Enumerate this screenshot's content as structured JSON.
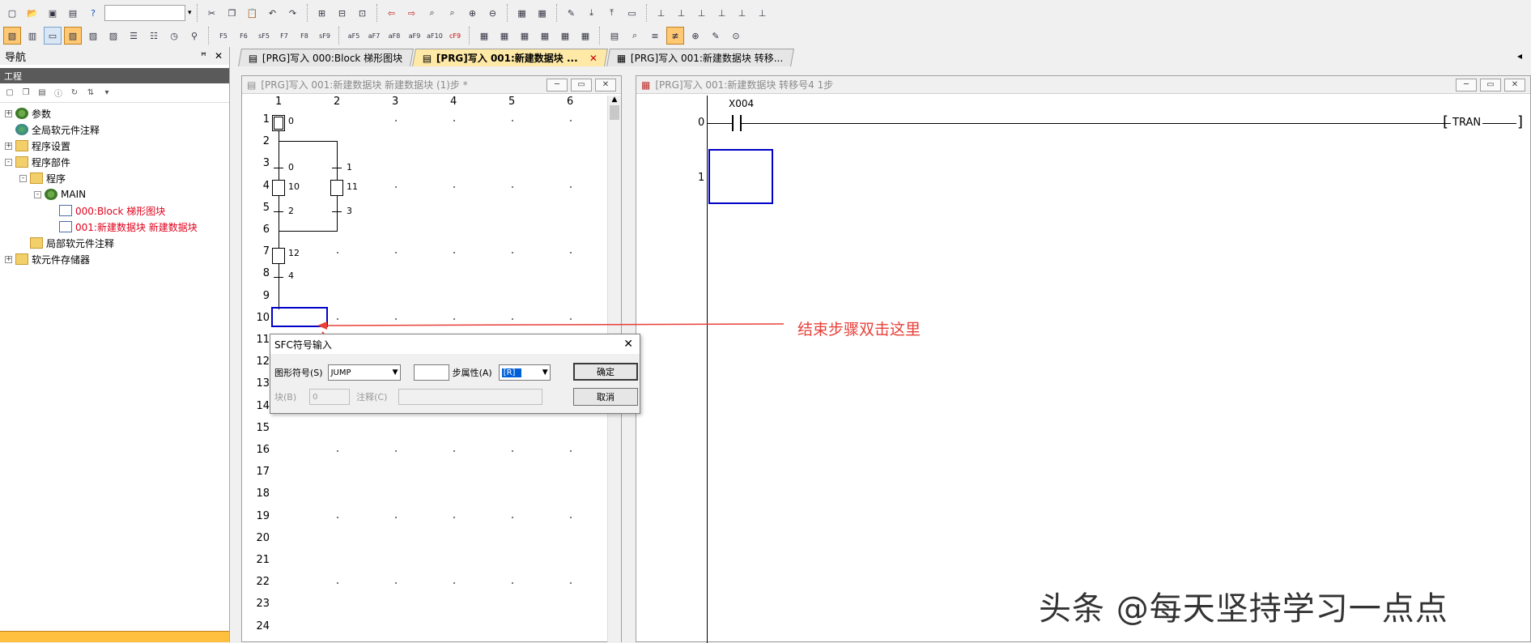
{
  "toolbar": {
    "combo1": "",
    "row1_icons": [
      "new-icon",
      "open-icon",
      "save-icon",
      "print-icon",
      "help-icon",
      "cut-icon",
      "copy-icon",
      "paste-icon",
      "undo-icon",
      "redo-icon",
      "dev-icon",
      "dev2-icon",
      "ocr-icon",
      "find-icon",
      "jump-icon",
      "zoom-icon",
      "device-icon",
      "f-icon",
      "monitor-icon"
    ],
    "row2_labels": [
      "F5",
      "F6",
      "sF5",
      "F7",
      "F8",
      "sF9",
      "aF5",
      "aF7",
      "aF8",
      "aF9",
      "aF10",
      "cF9"
    ]
  },
  "nav": {
    "title": "导航",
    "pin": "ꟸ",
    "close": "✕",
    "section": "工程",
    "tree": [
      {
        "label": "参数",
        "level": 0,
        "expander": "+",
        "icon": "gear"
      },
      {
        "label": "全局软元件注释",
        "level": 0,
        "expander": "",
        "icon": "globe"
      },
      {
        "label": "程序设置",
        "level": 0,
        "expander": "+",
        "icon": "folder"
      },
      {
        "label": "程序部件",
        "level": 0,
        "expander": "−",
        "icon": "folder"
      },
      {
        "label": "程序",
        "level": 1,
        "expander": "−",
        "icon": "folder"
      },
      {
        "label": "MAIN",
        "level": 2,
        "expander": "−",
        "icon": "gear"
      },
      {
        "label": "000:Block 梯形图块",
        "level": 3,
        "expander": "",
        "icon": "doc",
        "red": true
      },
      {
        "label": "001:新建数据块 新建数据块",
        "level": 3,
        "expander": "",
        "icon": "doc",
        "red": true
      },
      {
        "label": "局部软元件注释",
        "level": 1,
        "expander": "",
        "icon": "folder"
      },
      {
        "label": "软元件存储器",
        "level": 0,
        "expander": "+",
        "icon": "folder"
      }
    ]
  },
  "tabs": [
    {
      "label": "[PRG]写入 000:Block 梯形图块",
      "active": false
    },
    {
      "label": "[PRG]写入 001:新建数据块 ...",
      "active": true,
      "close": "✕"
    },
    {
      "label": "[PRG]写入 001:新建数据块 转移...",
      "active": false
    }
  ],
  "sfc_window": {
    "title": "[PRG]写入 001:新建数据块 新建数据块 (1)步 *",
    "columns": [
      "1",
      "2",
      "3",
      "4",
      "5",
      "6"
    ],
    "rows": [
      "1",
      "2",
      "3",
      "4",
      "5",
      "6",
      "7",
      "8",
      "9",
      "10",
      "11",
      "12",
      "13",
      "14",
      "15",
      "16",
      "17",
      "18",
      "19",
      "20",
      "21",
      "22",
      "23",
      "24"
    ],
    "step_labels": {
      "s0": "0",
      "s10": "10",
      "s11": "11",
      "s12": "12"
    },
    "transition_labels": {
      "t0": "0",
      "t1": "1",
      "t2": "2",
      "t3": "3",
      "t4": "4"
    }
  },
  "ladder_window": {
    "title": "[PRG]写入 001:新建数据块 转移号4 1步",
    "row0": "0",
    "row1": "1",
    "contact": "X004",
    "coil": "TRAN"
  },
  "dialog": {
    "title": "SFC符号输入",
    "close": "✕",
    "symbol_label": "图形符号(S)",
    "symbol_value": "JUMP",
    "attr_label": "步属性(A)",
    "attr_value": "[R]",
    "block_label": "块(B)",
    "block_value": "0",
    "comment_label": "注释(C)",
    "ok": "确定",
    "cancel": "取消"
  },
  "annotation": "结束步骤双击这里",
  "watermark": "头条 @每天坚持学习一点点",
  "colors": {
    "annotation_red": "#e8403a",
    "selection_blue": "#0000c8",
    "accent_orange": "#ffc040"
  }
}
